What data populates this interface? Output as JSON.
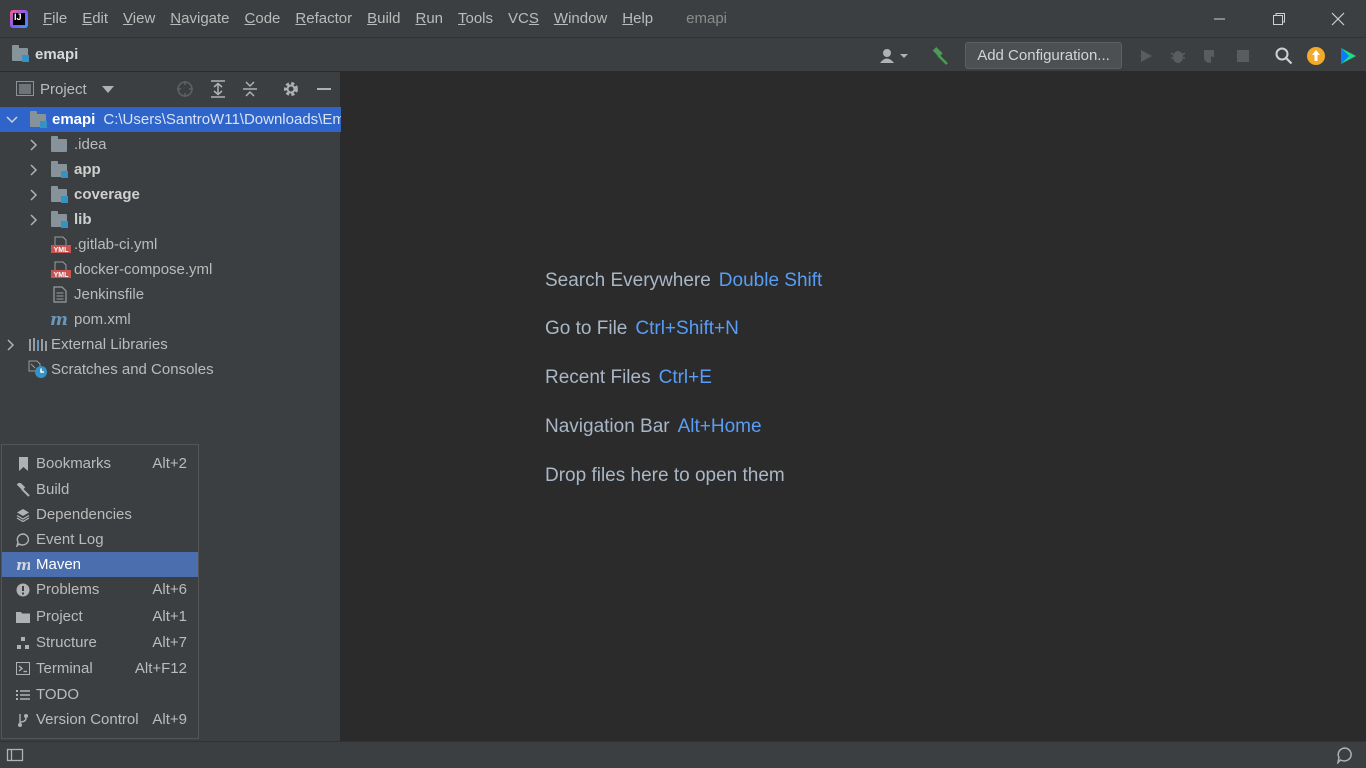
{
  "app": {
    "logo_text": "IJ",
    "window_title": "emapi"
  },
  "menu": [
    {
      "mn": "F",
      "rest": "ile"
    },
    {
      "mn": "E",
      "rest": "dit"
    },
    {
      "mn": "V",
      "rest": "iew"
    },
    {
      "mn": "N",
      "rest": "avigate"
    },
    {
      "mn": "C",
      "rest": "ode"
    },
    {
      "mn": "R",
      "rest": "efactor"
    },
    {
      "mn": "B",
      "rest": "uild"
    },
    {
      "mn": "R",
      "rest": "un"
    },
    {
      "mn": "T",
      "rest": "ools"
    },
    {
      "pre": "VC",
      "mn": "S",
      "rest": ""
    },
    {
      "mn": "W",
      "rest": "indow"
    },
    {
      "mn": "H",
      "rest": "elp"
    }
  ],
  "navbar": {
    "project_name": "emapi",
    "add_configuration": "Add Configuration..."
  },
  "project_panel": {
    "title": "Project",
    "root": {
      "name": "emapi",
      "path": "C:\\Users\\SantroW11\\Downloads\\Em"
    },
    "items": [
      {
        "label": ".idea",
        "bold": false
      },
      {
        "label": "app",
        "bold": true
      },
      {
        "label": "coverage",
        "bold": true
      },
      {
        "label": "lib",
        "bold": true
      },
      {
        "label": ".gitlab-ci.yml"
      },
      {
        "label": "docker-compose.yml"
      },
      {
        "label": "Jenkinsfile"
      },
      {
        "label": "pom.xml"
      }
    ],
    "external_libraries": "External Libraries",
    "scratches": "Scratches and Consoles"
  },
  "tool_windows": [
    {
      "label": "Bookmarks",
      "shortcut": "Alt+2",
      "icon": "bookmark-icon"
    },
    {
      "label": "Build",
      "shortcut": "",
      "icon": "hammer-icon"
    },
    {
      "label": "Dependencies",
      "shortcut": "",
      "icon": "layers-icon"
    },
    {
      "label": "Event Log",
      "shortcut": "",
      "icon": "speech-bubble-icon"
    },
    {
      "label": "Maven",
      "shortcut": "",
      "icon": "maven-icon",
      "active": true
    },
    {
      "label": "Problems",
      "shortcut": "Alt+6",
      "icon": "problems-icon"
    },
    {
      "label": "Project",
      "shortcut": "Alt+1",
      "icon": "folder-icon"
    },
    {
      "label": "Structure",
      "shortcut": "Alt+7",
      "icon": "structure-icon"
    },
    {
      "label": "Terminal",
      "shortcut": "Alt+F12",
      "icon": "terminal-icon"
    },
    {
      "label": "TODO",
      "shortcut": "",
      "icon": "list-icon"
    },
    {
      "label": "Version Control",
      "shortcut": "Alt+9",
      "icon": "vcs-icon"
    }
  ],
  "editor_hints": [
    {
      "text": "Search Everywhere",
      "shortcut": "Double Shift"
    },
    {
      "text": "Go to File",
      "shortcut": "Ctrl+Shift+N"
    },
    {
      "text": "Recent Files",
      "shortcut": "Ctrl+E"
    },
    {
      "text": "Navigation Bar",
      "shortcut": "Alt+Home"
    },
    {
      "text": "Drop files here to open them",
      "shortcut": ""
    }
  ],
  "colors": {
    "accent_link": "#589df6",
    "selection_active": "#4b6eaf",
    "tree_selection": "#0d293e",
    "module_badge": "#3592c4",
    "build_hammer": "#499c54",
    "update_badge": "#f4a928"
  }
}
